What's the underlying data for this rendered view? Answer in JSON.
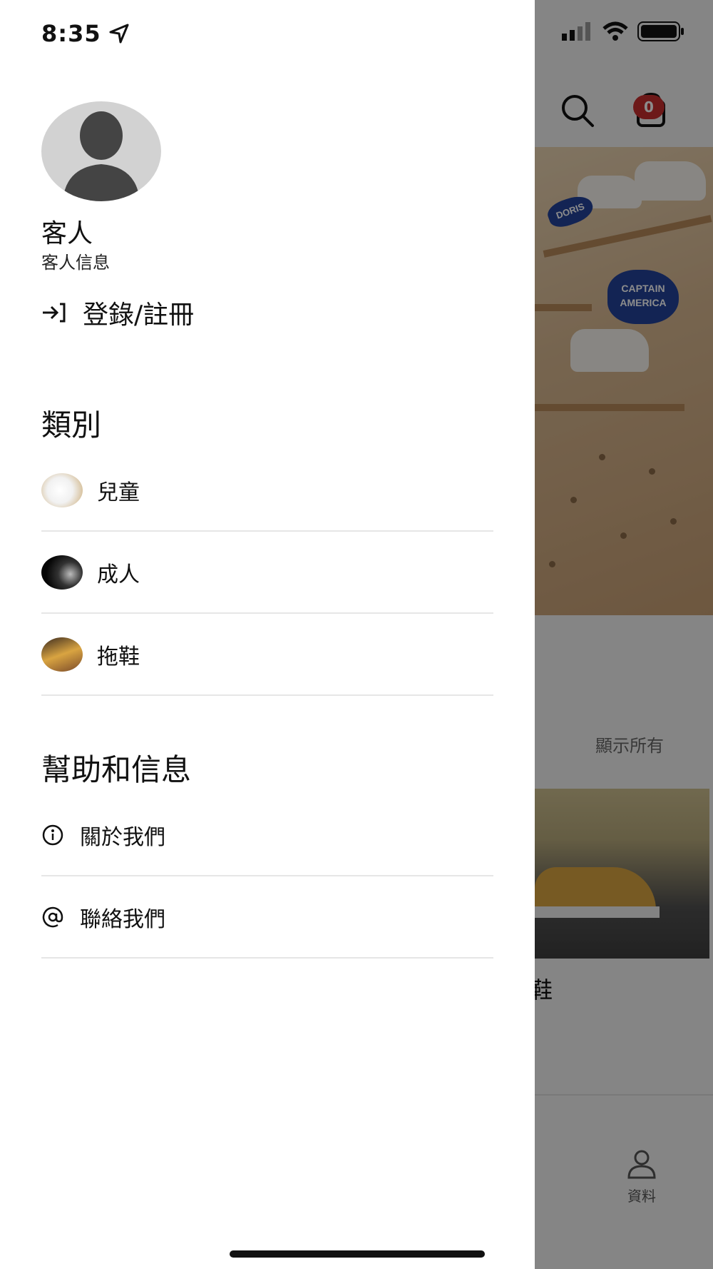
{
  "status_bar": {
    "time": "8:35"
  },
  "user": {
    "name": "客人",
    "subtitle": "客人信息"
  },
  "login": {
    "label": "登錄/註冊"
  },
  "categories": {
    "title": "類別",
    "items": [
      {
        "label": "兒童"
      },
      {
        "label": "成人"
      },
      {
        "label": "拖鞋"
      }
    ]
  },
  "help": {
    "title": "幫助和信息",
    "items": [
      {
        "label": "關於我們",
        "icon": "info-icon"
      },
      {
        "label": "聯絡我們",
        "icon": "at-icon"
      }
    ]
  },
  "background": {
    "cart_count": "0",
    "hero_stickers": [
      "DORIS",
      "CAPTAIN AMERICA"
    ],
    "show_all": "顯示所有",
    "product_title_fragment": "鞋",
    "tab_label": "資料"
  },
  "colors": {
    "badge": "#c62f2f",
    "overlay": "rgba(0,0,0,0.45)"
  }
}
